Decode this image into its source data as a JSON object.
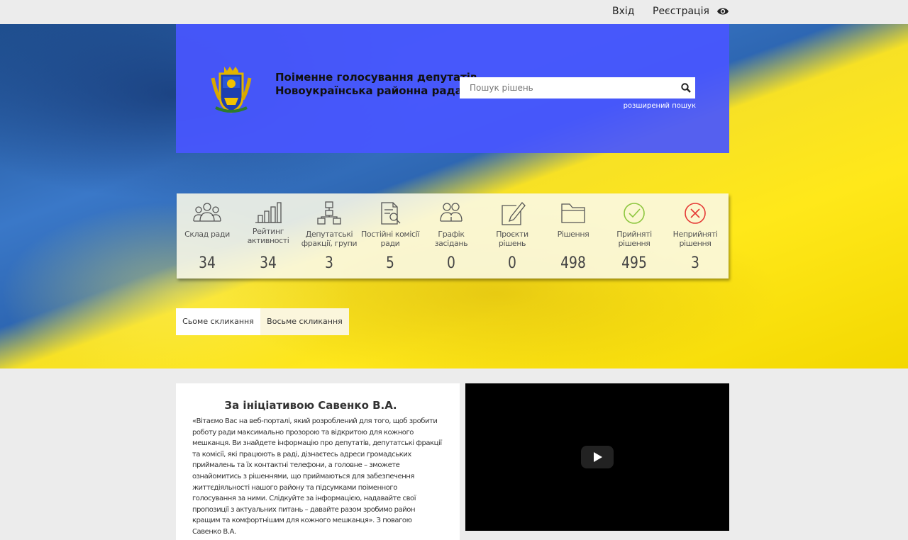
{
  "topbar": {
    "login": "Вхід",
    "register": "Реєстрація",
    "visibility_icon": "eye-icon"
  },
  "header": {
    "title_line1": "Поіменне голосування депутатів",
    "title_line2": "Новоукраїнська районна рада",
    "search_placeholder": "Пошук рішень",
    "advanced_search": "розширений пошук",
    "logo_icon": "coat-of-arms"
  },
  "stats": [
    {
      "label": "Склад ради",
      "value": "34",
      "icon": "people-group-icon"
    },
    {
      "label": "Рейтинг активності",
      "value": "34",
      "icon": "bar-chart-icon"
    },
    {
      "label": "Депутатські фракції, групи",
      "value": "3",
      "icon": "hierarchy-icon"
    },
    {
      "label": "Постійні комісії ради",
      "value": "5",
      "icon": "document-search-icon"
    },
    {
      "label": "Графік засідань",
      "value": "0",
      "icon": "meeting-icon"
    },
    {
      "label": "Проєкти рішень",
      "value": "0",
      "icon": "edit-document-icon"
    },
    {
      "label": "Рішення",
      "value": "498",
      "icon": "folder-icon"
    },
    {
      "label": "Прийняті рішення",
      "value": "495",
      "icon": "check-circle-icon"
    },
    {
      "label": "Неприйняті рішення",
      "value": "3",
      "icon": "x-circle-icon"
    }
  ],
  "tabs": {
    "active": "Сьоме скликання",
    "inactive": "Восьме скликання"
  },
  "intro": {
    "title": "За ініціативою Савенко В.А.",
    "text": "«Вітаємо Вас на веб-порталі, який розроблений для того, щоб зробити роботу ради максимально прозорою та відкритою для кожного мешканця. Ви знайдете інформацію про депутатів, депутатські фракції та комісії, які працюють в раді, дізнаєтесь адреси громадських приймалень та їх контактні телефони, а головне – зможете ознайомитись з рішеннями, що приймаються для забезпечення життєдіяльності нашого району та підсумками поіменного голосування за ними. Слідкуйте за інформацією, надавайте свої пропозиції з актуальних питань – давайте разом зробимо район кращим та комфортнішим для кожного мешканця». З повагою Савенко В.А."
  },
  "colors": {
    "header_panel": "#4856ff",
    "accept": "#8dc63f",
    "reject": "#e53935"
  }
}
